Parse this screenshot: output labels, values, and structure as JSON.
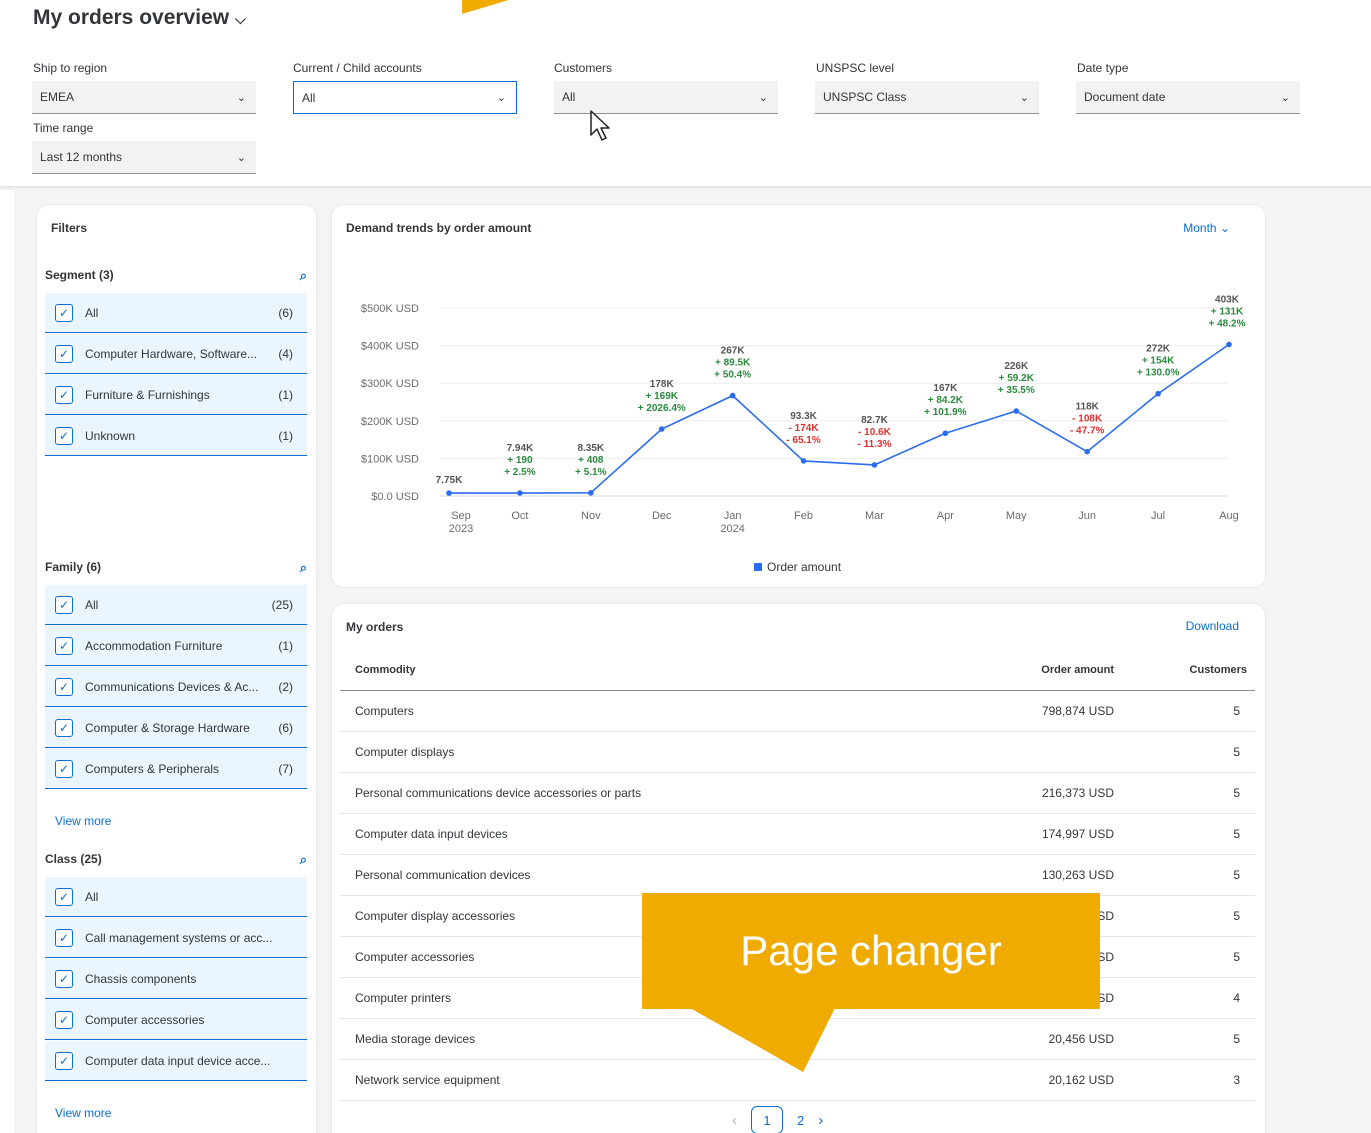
{
  "header": {
    "title": "My orders overview",
    "filters": [
      {
        "label": "Ship to region",
        "value": "EMEA"
      },
      {
        "label": "Current / Child accounts",
        "value": "All"
      },
      {
        "label": "Customers",
        "value": "All"
      },
      {
        "label": "UNSPSC level",
        "value": "UNSPSC Class"
      },
      {
        "label": "Date type",
        "value": "Document date"
      },
      {
        "label": "Time range",
        "value": "Last 12 months"
      }
    ]
  },
  "filters_panel": {
    "title": "Filters",
    "segment": {
      "header": "Segment (3)",
      "items": [
        {
          "label": "All",
          "count": "(6)"
        },
        {
          "label": "Computer Hardware, Software...",
          "count": "(4)"
        },
        {
          "label": "Furniture & Furnishings",
          "count": "(1)"
        },
        {
          "label": "Unknown",
          "count": "(1)"
        }
      ]
    },
    "family": {
      "header": "Family (6)",
      "items": [
        {
          "label": "All",
          "count": "(25)"
        },
        {
          "label": "Accommodation Furniture",
          "count": "(1)"
        },
        {
          "label": "Communications Devices & Ac...",
          "count": "(2)"
        },
        {
          "label": "Computer & Storage Hardware",
          "count": "(6)"
        },
        {
          "label": "Computers & Peripherals",
          "count": "(7)"
        }
      ],
      "view_more": "View more"
    },
    "class": {
      "header": "Class (25)",
      "items": [
        {
          "label": "All"
        },
        {
          "label": "Call management systems or acc..."
        },
        {
          "label": "Chassis components"
        },
        {
          "label": "Computer accessories"
        },
        {
          "label": "Computer data input device acce..."
        }
      ],
      "view_more": "View more"
    }
  },
  "chart": {
    "title": "Demand trends by order amount",
    "period_selector": "Month",
    "legend": "Order amount",
    "colors": {
      "line": "#2b6cf0",
      "positive": "#2b8a3e",
      "negative": "#e03131"
    }
  },
  "chart_data": {
    "type": "line",
    "title": "Demand trends by order amount",
    "y_ticks": [
      "$500K USD",
      "$400K USD",
      "$300K USD",
      "$200K USD",
      "$100K USD",
      "$0.0 USD"
    ],
    "ylim": [
      0,
      500000
    ],
    "x": [
      {
        "month": "Sep",
        "year": "2023"
      },
      {
        "month": "Oct",
        "year": ""
      },
      {
        "month": "Nov",
        "year": ""
      },
      {
        "month": "Dec",
        "year": ""
      },
      {
        "month": "Jan",
        "year": "2024"
      },
      {
        "month": "Feb",
        "year": ""
      },
      {
        "month": "Mar",
        "year": ""
      },
      {
        "month": "Apr",
        "year": ""
      },
      {
        "month": "May",
        "year": ""
      },
      {
        "month": "Jun",
        "year": ""
      },
      {
        "month": "Jul",
        "year": ""
      },
      {
        "month": "Aug",
        "year": ""
      }
    ],
    "series": [
      {
        "name": "Order amount",
        "values": [
          7750,
          7940,
          8350,
          178000,
          267000,
          93300,
          82700,
          167000,
          226000,
          118000,
          272000,
          403000
        ],
        "labels": [
          "7.75K",
          "7.94K",
          "8.35K",
          "178K",
          "267K",
          "93.3K",
          "82.7K",
          "167K",
          "226K",
          "118K",
          "272K",
          "403K"
        ],
        "deltas": [
          null,
          {
            "abs": "+ 190",
            "pct": "+ 2.5%",
            "dir": "up"
          },
          {
            "abs": "+ 408",
            "pct": "+ 5.1%",
            "dir": "up"
          },
          {
            "abs": "+ 169K",
            "pct": "+ 2026.4%",
            "dir": "up"
          },
          {
            "abs": "+ 89.5K",
            "pct": "+ 50.4%",
            "dir": "up"
          },
          {
            "abs": "- 174K",
            "pct": "- 65.1%",
            "dir": "down"
          },
          {
            "abs": "- 10.6K",
            "pct": "- 11.3%",
            "dir": "down"
          },
          {
            "abs": "+ 84.2K",
            "pct": "+ 101.9%",
            "dir": "up"
          },
          {
            "abs": "+ 59.2K",
            "pct": "+ 35.5%",
            "dir": "up"
          },
          {
            "abs": "- 108K",
            "pct": "- 47.7%",
            "dir": "down"
          },
          {
            "abs": "+ 154K",
            "pct": "+ 130.0%",
            "dir": "up"
          },
          {
            "abs": "+ 131K",
            "pct": "+ 48.2%",
            "dir": "up"
          }
        ]
      }
    ]
  },
  "orders": {
    "title": "My orders",
    "download": "Download",
    "columns": [
      "Commodity",
      "Order amount",
      "Customers"
    ],
    "rows": [
      {
        "commodity": "Computers",
        "amount": "798,874 USD",
        "customers": "5"
      },
      {
        "commodity": "Computer displays",
        "amount": "",
        "customers": "5"
      },
      {
        "commodity": "Personal communications device accessories or parts",
        "amount": "216,373 USD",
        "customers": "5"
      },
      {
        "commodity": "Computer data input devices",
        "amount": "174,997 USD",
        "customers": "5"
      },
      {
        "commodity": "Personal communication devices",
        "amount": "130,263 USD",
        "customers": "5"
      },
      {
        "commodity": "Computer display accessories",
        "amount": "SD",
        "customers": "5"
      },
      {
        "commodity": "Computer accessories",
        "amount": "SD",
        "customers": "5"
      },
      {
        "commodity": "Computer printers",
        "amount": "SD",
        "customers": "4"
      },
      {
        "commodity": "Media storage devices",
        "amount": "20,456 USD",
        "customers": "5"
      },
      {
        "commodity": "Network service equipment",
        "amount": "20,162 USD",
        "customers": "3"
      }
    ],
    "pager": {
      "prev": "‹",
      "pages": [
        "1",
        "2"
      ],
      "current": "1",
      "next": "›"
    }
  },
  "callout": {
    "text": "Page changer",
    "color": "#f0ab00"
  }
}
